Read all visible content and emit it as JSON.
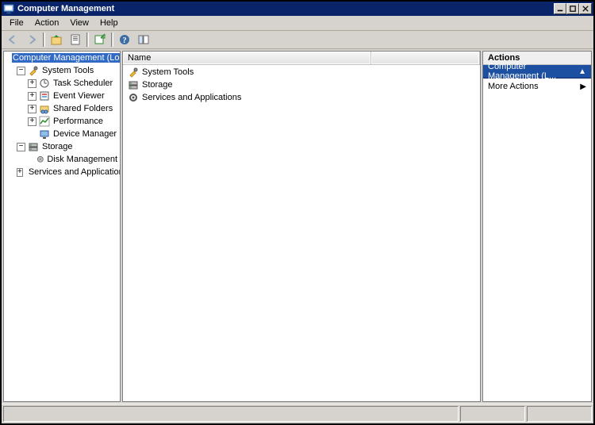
{
  "window": {
    "title": "Computer Management"
  },
  "menubar": {
    "file": "File",
    "action": "Action",
    "view": "View",
    "help": "Help"
  },
  "tree": {
    "root": "Computer Management (Local)",
    "system_tools": "System Tools",
    "task_scheduler": "Task Scheduler",
    "event_viewer": "Event Viewer",
    "shared_folders": "Shared Folders",
    "performance": "Performance",
    "device_manager": "Device Manager",
    "storage": "Storage",
    "disk_management": "Disk Management",
    "services_and_apps": "Services and Applications"
  },
  "list": {
    "header_name": "Name",
    "items": {
      "system_tools": "System Tools",
      "storage": "Storage",
      "services_and_apps": "Services and Applications"
    }
  },
  "actions": {
    "header": "Actions",
    "section": "Computer Management (L...",
    "more_actions": "More Actions"
  }
}
